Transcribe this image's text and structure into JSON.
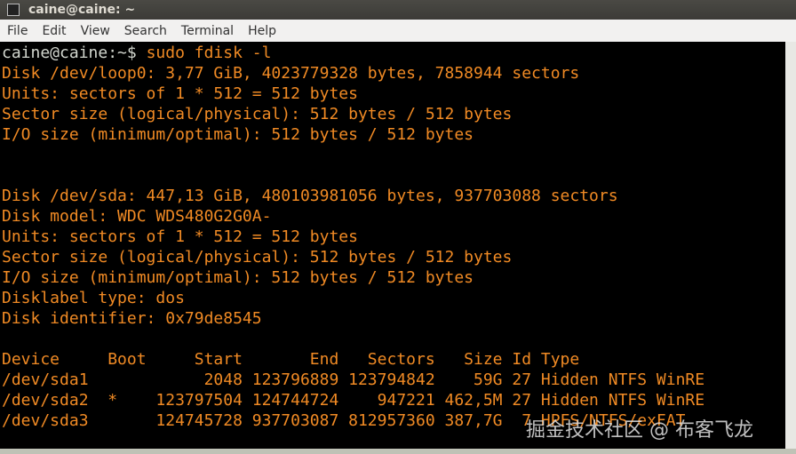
{
  "window": {
    "title": "caine@caine: ~"
  },
  "menu": [
    "File",
    "Edit",
    "View",
    "Search",
    "Terminal",
    "Help"
  ],
  "terminal": {
    "prompt": "caine@caine:~$ ",
    "command": "sudo fdisk -l",
    "lines": [
      "Disk /dev/loop0: 3,77 GiB, 4023779328 bytes, 7858944 sectors",
      "Units: sectors of 1 * 512 = 512 bytes",
      "Sector size (logical/physical): 512 bytes / 512 bytes",
      "I/O size (minimum/optimal): 512 bytes / 512 bytes",
      "",
      "",
      "Disk /dev/sda: 447,13 GiB, 480103981056 bytes, 937703088 sectors",
      "Disk model: WDC WDS480G2G0A-",
      "Units: sectors of 1 * 512 = 512 bytes",
      "Sector size (logical/physical): 512 bytes / 512 bytes",
      "I/O size (minimum/optimal): 512 bytes / 512 bytes",
      "Disklabel type: dos",
      "Disk identifier: 0x79de8545",
      "",
      "Device     Boot     Start       End   Sectors   Size Id Type",
      "/dev/sda1            2048 123796889 123794842    59G 27 Hidden NTFS WinRE",
      "/dev/sda2  *    123797504 124744724    947221 462,5M 27 Hidden NTFS WinRE",
      "/dev/sda3       124745728 937703087 812957360 387,7G  7 HPFS/NTFS/exFAT"
    ]
  },
  "watermark": "掘金技术社区 @ 布客飞龙"
}
